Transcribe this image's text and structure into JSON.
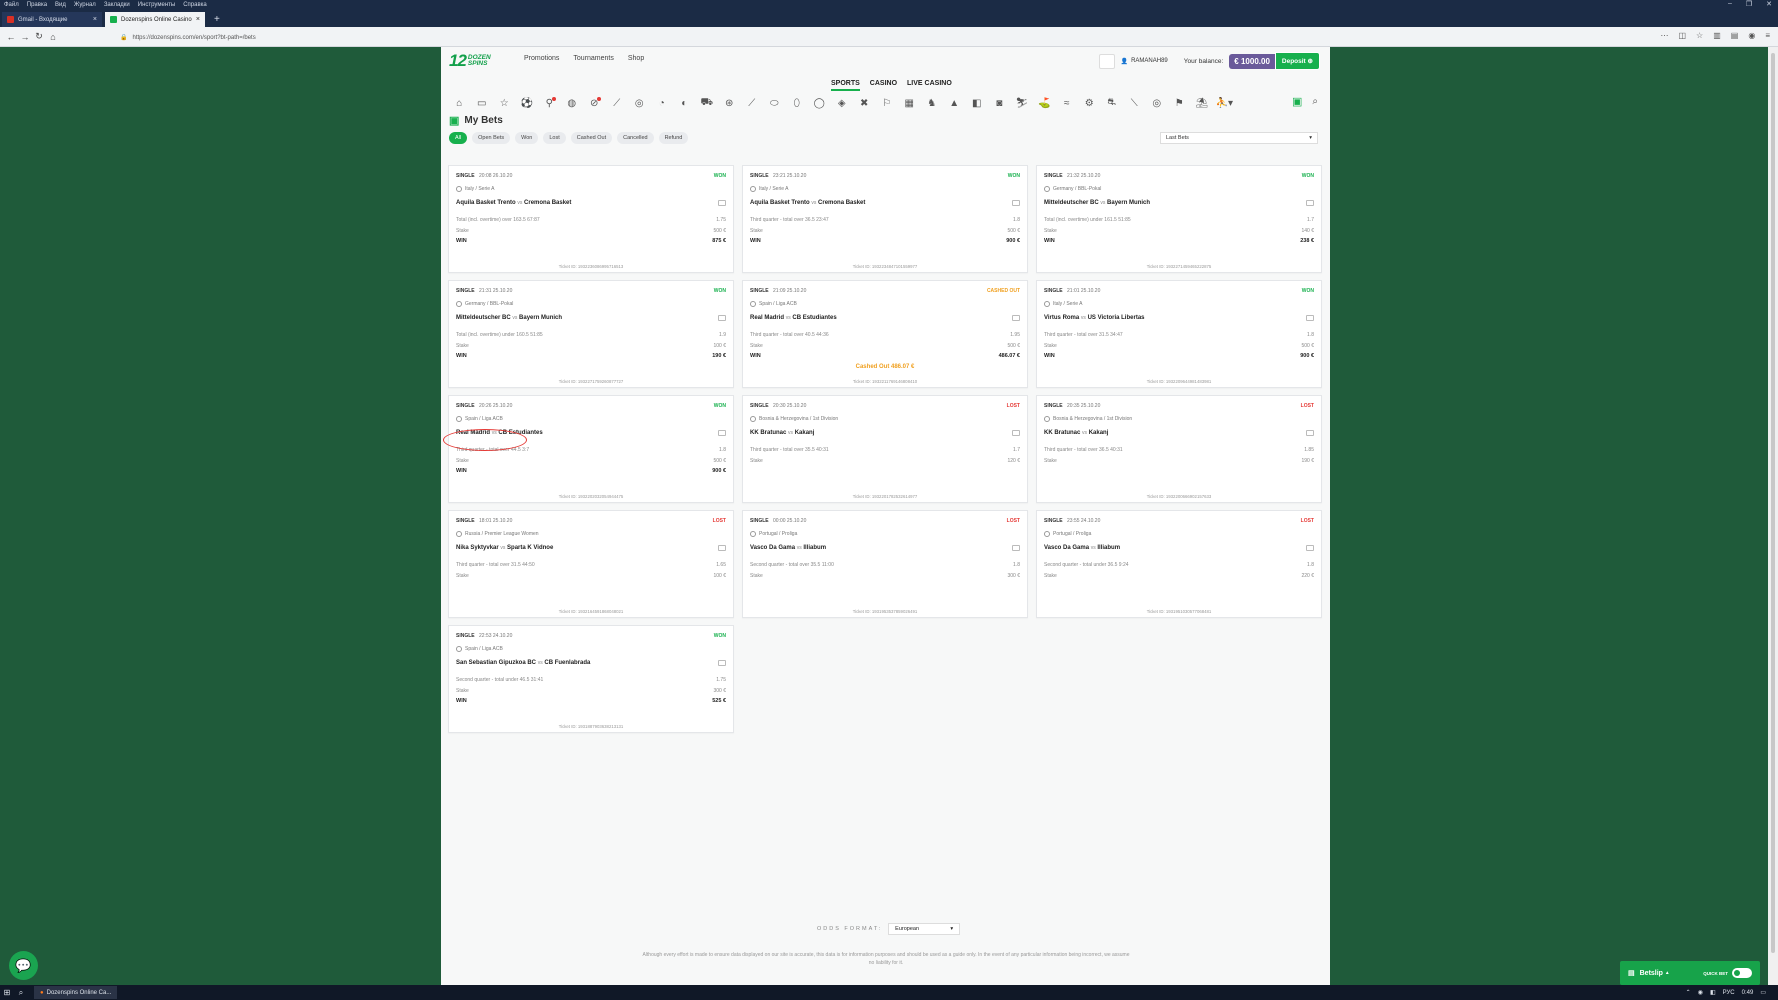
{
  "browser": {
    "menu": [
      "Файл",
      "Правка",
      "Вид",
      "Журнал",
      "Закладки",
      "Инструменты",
      "Справка"
    ],
    "tabs": [
      {
        "title": "Gmail - Входящие"
      },
      {
        "title": "Dozenspins Online Casino"
      }
    ],
    "url": "https://dozenspins.com/en/sport?bt-path=/bets"
  },
  "header": {
    "logo_num": "12",
    "logo_line1": "DOZEN",
    "logo_line2": "SPINS",
    "nav": [
      "Promotions",
      "Tournaments",
      "Shop"
    ],
    "username": "RAMANAH89",
    "balance_label": "Your balance:",
    "balance": "€ 1000.00",
    "deposit": "Deposit"
  },
  "top_tabs": [
    "SPORTS",
    "CASINO",
    "LIVE CASINO"
  ],
  "page_title": "My Bets",
  "filters": [
    "All",
    "Open Bets",
    "Won",
    "Lost",
    "Cashed Out",
    "Cancelled",
    "Refund"
  ],
  "period_select": "Last Bets",
  "status_colors": {
    "won": "#17b04d",
    "lost": "#e53935",
    "cashed": "#f0a020"
  },
  "bets": [
    {
      "type": "SINGLE",
      "date": "20:08 26.10.20",
      "status": "WON",
      "league": "Italy / Serie A",
      "home": "Aquila Basket Trento",
      "vs": "vs",
      "away": "Cremona Basket",
      "market": "Total (incl. overtime) over 163.5  67:87",
      "odd": "1.75",
      "stake_label": "Stake",
      "stake": "500 €",
      "win_label": "WIN",
      "win": "875 €",
      "ticket": "Ticket ID: 1932236086995716513"
    },
    {
      "type": "SINGLE",
      "date": "23:21 25.10.20",
      "status": "WON",
      "league": "Italy / Serie A",
      "home": "Aquila Basket Trento",
      "vs": "vs",
      "away": "Cremona Basket",
      "market": "Third quarter - total over 36.5  23:47",
      "odd": "1.8",
      "stake_label": "Stake",
      "stake": "500 €",
      "win_label": "WIN",
      "win": "900 €",
      "ticket": "Ticket ID: 1932234847101559977"
    },
    {
      "type": "SINGLE",
      "date": "21:32 25.10.20",
      "status": "WON",
      "league": "Germany / BBL-Pokal",
      "home": "Mitteldeutscher BC",
      "vs": "vs",
      "away": "Bayern Munich",
      "market": "Total (incl. overtime) under 161.5  51:85",
      "odd": "1.7",
      "stake_label": "Stake",
      "stake": "140 €",
      "win_label": "WIN",
      "win": "238 €",
      "ticket": "Ticket ID: 1932271459465222875"
    },
    {
      "type": "SINGLE",
      "date": "21:31 25.10.20",
      "status": "WON",
      "league": "Germany / BBL-Pokal",
      "home": "Mitteldeutscher BC",
      "vs": "vs",
      "away": "Bayern Munich",
      "market": "Total (incl. overtime) under 160.5  51:85",
      "odd": "1.9",
      "stake_label": "Stake",
      "stake": "100 €",
      "win_label": "WIN",
      "win": "190 €",
      "ticket": "Ticket ID: 1932271759260877727"
    },
    {
      "type": "SINGLE",
      "date": "21:09 25.10.20",
      "status": "CASHED OUT",
      "league": "Spain / Liga ACB",
      "home": "Real Madrid",
      "vs": "vs",
      "away": "CB Estudiantes",
      "market": "Third quarter - total over 40.5  44:36",
      "odd": "1.95",
      "stake_label": "Stake",
      "stake": "500 €",
      "win_label": "WIN",
      "win": "486.07 €",
      "cashout": "Cashed Out 486.07 €",
      "ticket": "Ticket ID: 1932211769146808410"
    },
    {
      "type": "SINGLE",
      "date": "21:01 25.10.20",
      "status": "WON",
      "league": "Italy / Serie A",
      "home": "Virtus Roma",
      "vs": "vs",
      "away": "US Victoria Libertas",
      "market": "Third quarter - total over 31.5  34:47",
      "odd": "1.8",
      "stake_label": "Stake",
      "stake": "500 €",
      "win_label": "WIN",
      "win": "900 €",
      "ticket": "Ticket ID: 1932209644981483981"
    },
    {
      "type": "SINGLE",
      "date": "20:26 25.10.20",
      "status": "WON",
      "league": "Spain / Liga ACB",
      "home": "Real Madrid",
      "vs": "vs",
      "away": "CB Estudiantes",
      "market": "Third quarter - total over 44.5  3:7",
      "odd": "1.8",
      "stake_label": "Stake",
      "stake": "500 €",
      "win_label": "WIN",
      "win": "900 €",
      "ticket": "Ticket ID: 1932202032054944475"
    },
    {
      "type": "SINGLE",
      "date": "20:30 25.10.20",
      "status": "LOST",
      "league": "Bosnia & Herzegovina / 1st Division",
      "home": "KK Bratunac",
      "vs": "vs",
      "away": "Kakanj",
      "market": "Third quarter - total over 35.5  40:31",
      "odd": "1.7",
      "stake_label": "Stake",
      "stake": "120 €",
      "ticket": "Ticket ID: 1932201782532614977"
    },
    {
      "type": "SINGLE",
      "date": "20:35 25.10.20",
      "status": "LOST",
      "league": "Bosnia & Herzegovina / 1st Division",
      "home": "KK Bratunac",
      "vs": "vs",
      "away": "Kakanj",
      "market": "Third quarter - total over 36.5  40:31",
      "odd": "1.85",
      "stake_label": "Stake",
      "stake": "190 €",
      "ticket": "Ticket ID: 1932200666902157633"
    },
    {
      "type": "SINGLE",
      "date": "18:01 25.10.20",
      "status": "LOST",
      "league": "Russia / Premier League Women",
      "home": "Nika Syktyvkar",
      "vs": "vs",
      "away": "Sparta K Vidnoe",
      "market": "Third quarter - total over 31.5  44:50",
      "odd": "1.65",
      "stake_label": "Stake",
      "stake": "100 €",
      "ticket": "Ticket ID: 1932164591868048021"
    },
    {
      "type": "SINGLE",
      "date": "00:00 25.10.20",
      "status": "LOST",
      "league": "Portugal / Proliga",
      "home": "Vasco Da Gama",
      "vs": "vs",
      "away": "Illiabum",
      "market": "Second quarter - total over 35.5  11:00",
      "odd": "1.8",
      "stake_label": "Stake",
      "stake": "300 €",
      "ticket": "Ticket ID: 1931953537859026491"
    },
    {
      "type": "SINGLE",
      "date": "23:55 24.10.20",
      "status": "LOST",
      "league": "Portugal / Proliga",
      "home": "Vasco Da Gama",
      "vs": "vs",
      "away": "Illiabum",
      "market": "Second quarter - total under 36.5  9:24",
      "odd": "1.8",
      "stake_label": "Stake",
      "stake": "220 €",
      "ticket": "Ticket ID: 1931951030577068481"
    },
    {
      "type": "SINGLE",
      "date": "22:53 24.10.20",
      "status": "WON",
      "league": "Spain / Liga ACB",
      "home": "San Sebastian Gipuzkoa BC",
      "vs": "vs",
      "away": "CB Fuenlabrada",
      "market": "Second quarter - total under 46.5  31:41",
      "odd": "1.75",
      "stake_label": "Stake",
      "stake": "300 €",
      "win_label": "WIN",
      "win": "525 €",
      "ticket": "Ticket ID: 1931887903638213131"
    }
  ],
  "footer": {
    "odds_label": "ODDS FORMAT:",
    "odds_value": "European",
    "disclaimer": "Although every effort is made to ensure data displayed on our site is accurate, this data is for information purposes and should be used as a guide only. In the event of any particular information being incorrect, we assume no liability for it."
  },
  "betslip": {
    "label": "Betslip",
    "quick_bet": "QUICK BET"
  },
  "taskbar": {
    "app": "Dozenspins Online Ca...",
    "lang": "РУС",
    "time": "0:49"
  }
}
